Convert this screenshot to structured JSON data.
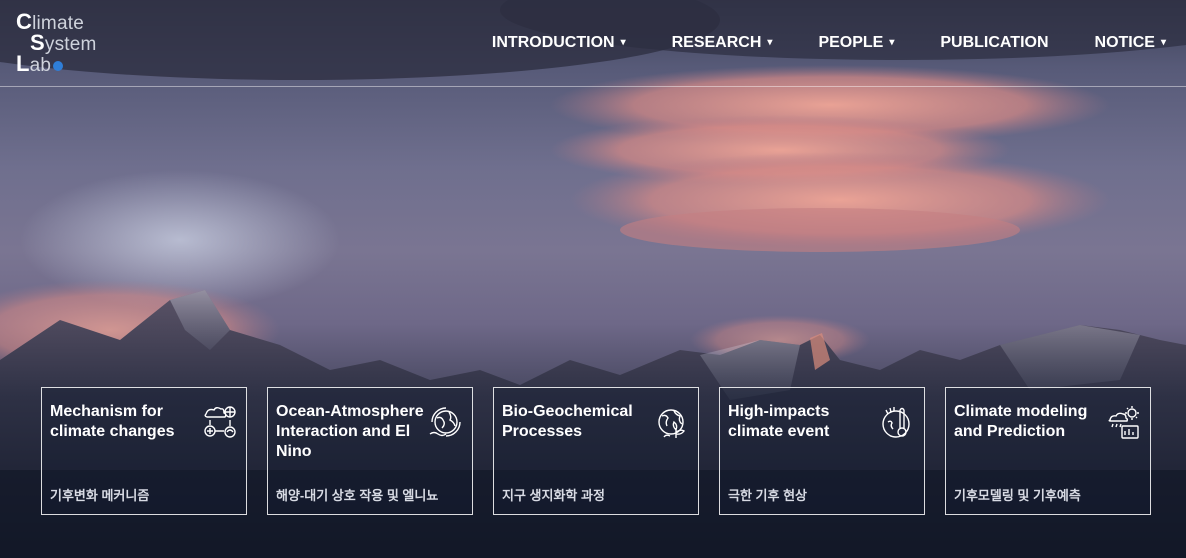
{
  "logo": {
    "line1": "limate",
    "line2": "ystem",
    "line3": "ab",
    "c": "C",
    "s": "S",
    "l": "L"
  },
  "nav": [
    {
      "label": "INTRODUCTION",
      "dropdown": true
    },
    {
      "label": "RESEARCH",
      "dropdown": true
    },
    {
      "label": "PEOPLE",
      "dropdown": true
    },
    {
      "label": "PUBLICATION",
      "dropdown": false
    },
    {
      "label": "NOTICE",
      "dropdown": true
    }
  ],
  "chevron": "⌄",
  "cards": [
    {
      "title": "Mechanism for climate changes",
      "subtitle": "기후변화 메커니즘",
      "icon": "climate-mechanism-icon"
    },
    {
      "title": "Ocean-Atmosphere Interaction and El Nino",
      "subtitle": "해양-대기 상호 작용 및 엘니뇨",
      "icon": "ocean-globe-icon"
    },
    {
      "title": "Bio-Geochemical Processes",
      "subtitle": "지구 생지화학 과정",
      "icon": "earth-plant-icon"
    },
    {
      "title": "High-impacts climate event",
      "subtitle": "극한 기후 현상",
      "icon": "thermometer-icon"
    },
    {
      "title": "Climate modeling and Prediction",
      "subtitle": "기후모델링 및 기후예측",
      "icon": "weather-forecast-icon"
    }
  ],
  "colors": {
    "cloud_pink": "#e59a8f",
    "sky_dark": "#3c3f55",
    "mountain": "#1c2234"
  }
}
